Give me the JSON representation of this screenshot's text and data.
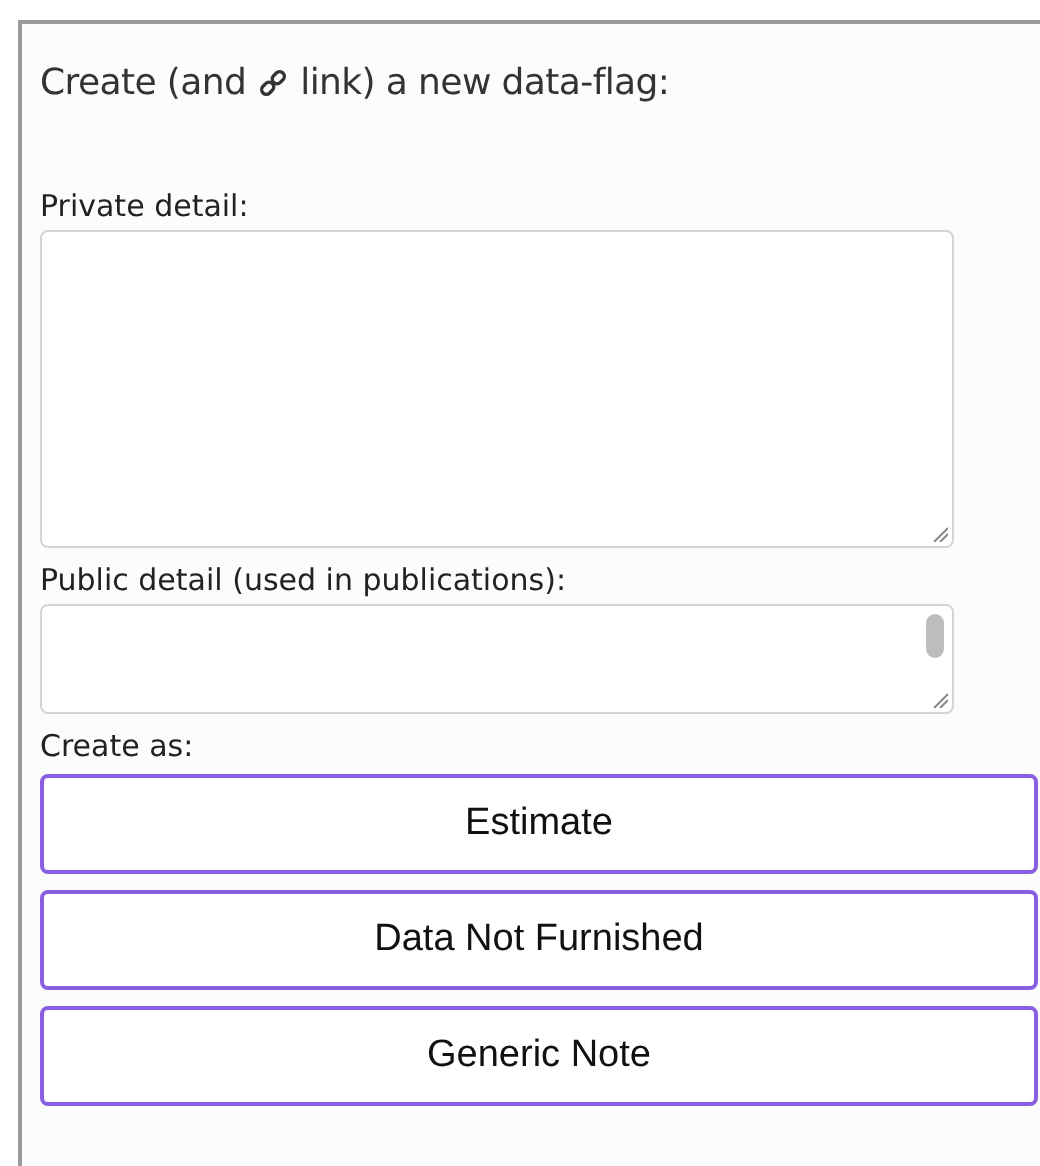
{
  "title": {
    "before_icon": "Create (and",
    "after_icon": "link) a new data-flag:"
  },
  "fields": [
    {
      "label": "Private detail:",
      "kind": "tall"
    },
    {
      "label": "Public detail (used in publications):",
      "kind": "scrolling"
    }
  ],
  "create_as": {
    "label": "Create as:",
    "buttons": [
      "Estimate",
      "Data Not Furnished",
      "Generic Note"
    ]
  }
}
